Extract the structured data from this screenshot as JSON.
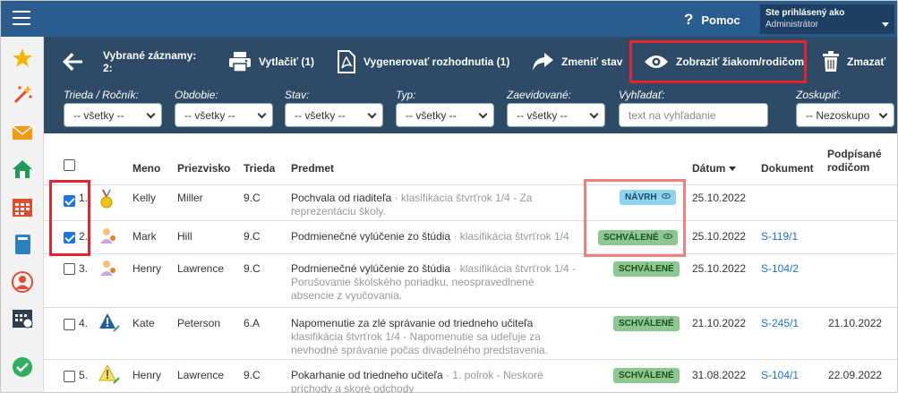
{
  "topbar": {
    "help_label": "Pomoc",
    "help_glyph": "?",
    "user_line1": "Ste prihlásený ako",
    "user_line2": "Administrátor"
  },
  "toolbar": {
    "selected_label": "Vybrané záznamy:",
    "selected_count": "2:",
    "print_label": "Vytlačiť (1)",
    "generate_label": "Vygenerovať rozhodnutia (1)",
    "change_state_label": "Zmeniť stav",
    "show_label": "Zobraziť žiakom/rodičom",
    "delete_label": "Zmazať"
  },
  "filters": {
    "class": {
      "label": "Trieda / Ročník:",
      "value": "-- všetky --"
    },
    "period": {
      "label": "Obdobie:",
      "value": "-- všetky --"
    },
    "state": {
      "label": "Stav:",
      "value": "-- všetky --"
    },
    "type": {
      "label": "Typ:",
      "value": "-- všetky --"
    },
    "registered": {
      "label": "Zaevidované:",
      "value": "-- všetky --"
    },
    "search": {
      "label": "Vyhľadať:",
      "placeholder": "text na vyhľadanie"
    },
    "group": {
      "label": "Zoskupiť:",
      "value": "-- Nezoskupo"
    }
  },
  "table": {
    "headers": {
      "name": "Meno",
      "surname": "Priezvisko",
      "class": "Trieda",
      "subject": "Predmet",
      "date": "Dátum",
      "document": "Dokument",
      "signed1": "Podpísané",
      "signed2": "rodičom"
    },
    "rows": [
      {
        "num": "1.",
        "checked": true,
        "name": "Kelly",
        "surname": "Miller",
        "class": "9.C",
        "title": "Pochvala od riaditeľa",
        "desc1": " · klasifikácia štvrťrok 1/4 - Za",
        "desc2": "reprezentáciu školy.",
        "desc3": "",
        "status": "NÁVRH",
        "status_type": "draft",
        "eye": true,
        "date": "25.10.2022",
        "doc": "",
        "signed": ""
      },
      {
        "num": "2.",
        "checked": true,
        "name": "Mark",
        "surname": "Hill",
        "class": "9.C",
        "title": "Podmienečné vylúčenie zo štúdia",
        "desc1": " · klasifikácia štvrťrok 1/4",
        "desc2": "",
        "desc3": "",
        "status": "SCHVÁLENÉ",
        "status_type": "ok",
        "eye": true,
        "date": "25.10.2022",
        "doc": "S-119/1",
        "signed": ""
      },
      {
        "num": "3.",
        "checked": false,
        "name": "Henry",
        "surname": "Lawrence",
        "class": "9.C",
        "title": "Podmienečné vylúčenie zo štúdia",
        "desc1": " · klasifikácia štvrťrok 1/4 -",
        "desc2": "Porušovanie školského poriadku, neospravedlnené",
        "desc3": "absencie z vyučovania.",
        "status": "SCHVÁLENÉ",
        "status_type": "ok",
        "eye": false,
        "date": "25.10.2022",
        "doc": "S-104/2",
        "signed": ""
      },
      {
        "num": "4.",
        "checked": false,
        "name": "Kate",
        "surname": "Peterson",
        "class": "6.A",
        "title": "Napomenutie za zlé správanie od triedneho učiteľa",
        "desc1": "",
        "desc2": "klasifikácia štvrťrok 1/4 - Napomenutie sa udeľuje za",
        "desc3": "nevhodné správanie počas divadelného predstavenia.",
        "status": "SCHVÁLENÉ",
        "status_type": "ok",
        "eye": false,
        "date": "21.10.2022",
        "doc": "S-245/1",
        "signed": "21.10.2022"
      },
      {
        "num": "5.",
        "checked": false,
        "name": "Henry",
        "surname": "Lawrence",
        "class": "9.C",
        "title": "Pokarhanie od triedneho učiteľa",
        "desc1": " · 1. polrok - Neskoré",
        "desc2": "príchody a skoré odchody",
        "desc3": "",
        "status": "SCHVÁLENÉ",
        "status_type": "ok",
        "eye": false,
        "date": "31.08.2022",
        "doc": "S-104/1",
        "signed": "22.09.2022"
      }
    ]
  },
  "colors": {
    "topbar": "#2a5c8e",
    "toolbar": "#2d4a67",
    "highlight": "#e4252f",
    "link": "#1a73c8"
  }
}
